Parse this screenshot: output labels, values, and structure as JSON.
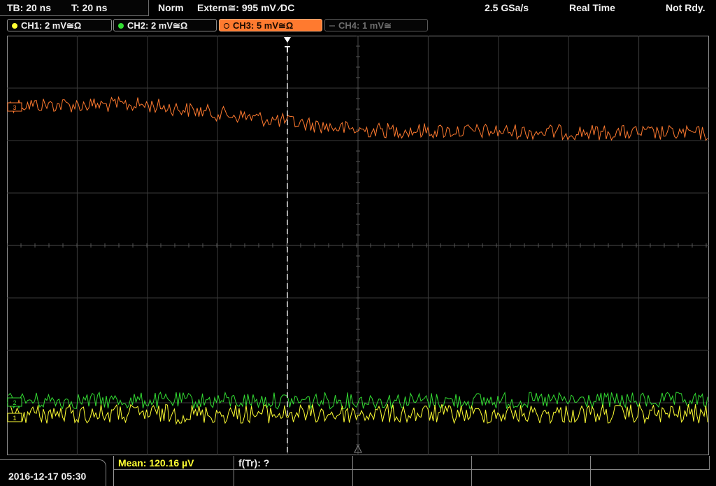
{
  "status": {
    "timebase": "TB: 20 ns",
    "trigger_time": "T: 20 ns",
    "mode": "Norm",
    "trigger_source": "Extern≅: 995 mV ⁄DC",
    "sample_rate": "2.5 GSa/s",
    "acq_mode": "Real Time",
    "state": "Not Rdy."
  },
  "channels": [
    {
      "label": "CH1: 2 mV≅Ω",
      "color": "#ffff33",
      "active": false,
      "enabled": true
    },
    {
      "label": "CH2: 2 mV≅Ω",
      "color": "#33dd33",
      "active": false,
      "enabled": true
    },
    {
      "label": "CH3: 5 mV≅Ω",
      "color": "#ff7a2f",
      "active": true,
      "enabled": true
    },
    {
      "label": "CH4: 1 mV≅",
      "color": "#555555",
      "active": false,
      "enabled": false
    }
  ],
  "waveform_colors": {
    "ch1": "#ffff33",
    "ch2": "#33dd33",
    "ch3": "#ff7a2f"
  },
  "markers": {
    "trigger_marker": "T"
  },
  "datetime": "2016-12-17 05:30",
  "measurements": {
    "mean": "Mean: 120.16 µV",
    "rise": "f(Tr): ?"
  }
}
